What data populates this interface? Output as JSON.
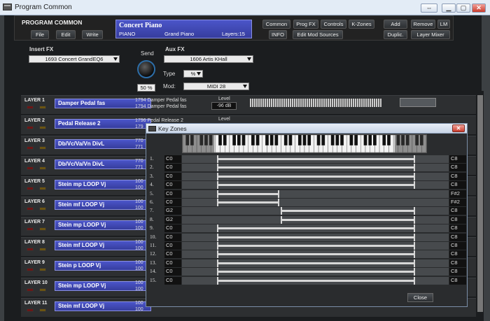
{
  "window": {
    "title": "Program Common"
  },
  "header": {
    "title": "PROGRAM COMMON",
    "buttons": [
      "File",
      "Edit",
      "Write"
    ],
    "program": {
      "name": "Concert Piano",
      "category": "PIANO",
      "subcategory": "Grand Piano",
      "layers": "Layers:15"
    },
    "right_buttons_row1": [
      "Common",
      "Prog FX",
      "Controls",
      "K-Zones",
      "Add",
      "Remove",
      "LM"
    ],
    "right_buttons_row2": [
      "INFO",
      "Edit Mod Sources",
      "Duplic.",
      "Layer Mixer"
    ]
  },
  "fx": {
    "insert_label": "Insert FX",
    "insert_value": "1693  Concert GrandEQ6",
    "send_label": "Send",
    "send_value": "50 %",
    "aux_label": "Aux FX",
    "aux_value": "1606  Artis KHall",
    "type_label": "Type",
    "type_value": "%",
    "mod_label": "Mod:",
    "mod_value": "MIDI 28"
  },
  "layers": [
    {
      "label": "LAYER 1",
      "name": "Damper Pedal fas",
      "sub1": "1794 Damper Pedal fas",
      "sub2": "1794 Damper Pedal fas",
      "level_label": "Level",
      "level": "-96 dB"
    },
    {
      "label": "LAYER 2",
      "name": "Pedal Release 2",
      "sub1": "1796 Pedal Release 2",
      "sub2": "179",
      "level_label": "Level",
      "level": ""
    },
    {
      "label": "LAYER 3",
      "name": "Db/Vc/Va/Vn DivL",
      "sub1": "770",
      "sub2": "771"
    },
    {
      "label": "LAYER 4",
      "name": "Db/Vc/Va/Vn DivL",
      "sub1": "770",
      "sub2": "771"
    },
    {
      "label": "LAYER 5",
      "name": "Stein mp LOOP Vj",
      "sub1": "100",
      "sub2": "100"
    },
    {
      "label": "LAYER 6",
      "name": "Stein mf LOOP Vj",
      "sub1": "100",
      "sub2": "100"
    },
    {
      "label": "LAYER 7",
      "name": "Stein mp LOOP Vj",
      "sub1": "100",
      "sub2": "100"
    },
    {
      "label": "LAYER 8",
      "name": "Stein mf LOOP Vj",
      "sub1": "100",
      "sub2": "100"
    },
    {
      "label": "LAYER 9",
      "name": "Stein p LOOP Vj",
      "sub1": "100",
      "sub2": "100"
    },
    {
      "label": "LAYER 10",
      "name": "Stein mp LOOP Vj",
      "sub1": "100",
      "sub2": "100"
    },
    {
      "label": "LAYER 11",
      "name": "Stein mf LOOP Vj",
      "sub1": "100",
      "sub2": "100"
    }
  ],
  "keyzones": {
    "title": "Key Zones",
    "close_label": "Close",
    "zones": [
      {
        "num": "1.",
        "lo": "C0",
        "hi": "C8",
        "from": 0.13,
        "to": 0.87
      },
      {
        "num": "2.",
        "lo": "C0",
        "hi": "C8",
        "from": 0.13,
        "to": 0.87
      },
      {
        "num": "3.",
        "lo": "C0",
        "hi": "C8",
        "from": 0.13,
        "to": 0.87
      },
      {
        "num": "4.",
        "lo": "C0",
        "hi": "C8",
        "from": 0.13,
        "to": 0.87
      },
      {
        "num": "5.",
        "lo": "C0",
        "hi": "F#2",
        "from": 0.13,
        "to": 0.36
      },
      {
        "num": "6.",
        "lo": "C0",
        "hi": "F#2",
        "from": 0.13,
        "to": 0.36
      },
      {
        "num": "7.",
        "lo": "G2",
        "hi": "C8",
        "from": 0.37,
        "to": 0.87
      },
      {
        "num": "8.",
        "lo": "G2",
        "hi": "C8",
        "from": 0.37,
        "to": 0.87
      },
      {
        "num": "9.",
        "lo": "C0",
        "hi": "C8",
        "from": 0.13,
        "to": 0.87
      },
      {
        "num": "10.",
        "lo": "C0",
        "hi": "C8",
        "from": 0.13,
        "to": 0.87
      },
      {
        "num": "11.",
        "lo": "C0",
        "hi": "C8",
        "from": 0.13,
        "to": 0.87
      },
      {
        "num": "12.",
        "lo": "C0",
        "hi": "C8",
        "from": 0.13,
        "to": 0.87
      },
      {
        "num": "13.",
        "lo": "C0",
        "hi": "C8",
        "from": 0.13,
        "to": 0.87
      },
      {
        "num": "14.",
        "lo": "C0",
        "hi": "C8",
        "from": 0.13,
        "to": 0.87
      },
      {
        "num": "15.",
        "lo": "C0",
        "hi": "C8",
        "from": 0.13,
        "to": 0.87
      }
    ]
  },
  "colors": {
    "program_blue": "#4b55c9",
    "background": "#1b1d1f"
  }
}
